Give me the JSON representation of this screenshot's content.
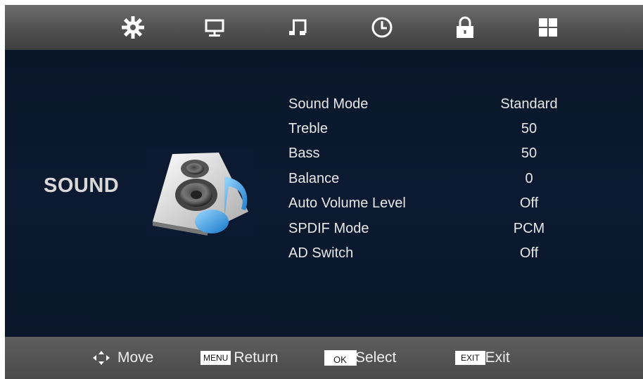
{
  "top_menu": {
    "tabs": [
      {
        "icon": "picture-sunburst-icon",
        "label": ""
      },
      {
        "icon": "monitor-icon",
        "label": ""
      },
      {
        "icon": "music-note-icon",
        "label": ""
      },
      {
        "icon": "clock-icon",
        "label": ""
      },
      {
        "icon": "lock-icon",
        "label": ""
      },
      {
        "icon": "grid-icon",
        "label": ""
      }
    ],
    "active_tab_index": 2
  },
  "section": {
    "title": "SOUND",
    "icon": "speaker-music-icon"
  },
  "settings": [
    {
      "label": "Sound Mode",
      "value": "Standard"
    },
    {
      "label": "Treble",
      "value": "50"
    },
    {
      "label": "Bass",
      "value": "50"
    },
    {
      "label": "Balance",
      "value": "0"
    },
    {
      "label": "Auto Volume Level",
      "value": "Off"
    },
    {
      "label": "SPDIF Mode",
      "value": "PCM"
    },
    {
      "label": "AD Switch",
      "value": "Off"
    }
  ],
  "footer": {
    "move": {
      "icon": "move-arrows-icon",
      "label": "Move"
    },
    "return": {
      "key": "MENU",
      "label": "Return"
    },
    "select": {
      "key": "OK",
      "label": "Select"
    },
    "exit": {
      "key": "EXIT",
      "label": "Exit"
    }
  },
  "colors": {
    "background": "#0a172b",
    "bar": "#555555",
    "text": "#e8e8e8",
    "accent_note": "#3aa3e6"
  }
}
